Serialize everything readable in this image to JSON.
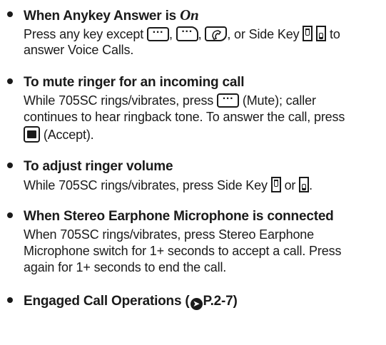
{
  "items": [
    {
      "head_pre": "When Anykey Answer is ",
      "head_em": "On",
      "l1_a": "Press any key except ",
      "l1_b": ", ",
      "l1_c": ", ",
      "l1_d": ", or Side Key ",
      "l1_e": " ",
      "l1_f": " to",
      "l2": "answer Voice Calls."
    },
    {
      "head": "To mute ringer for an incoming call",
      "l1_a": "While 705SC rings/vibrates, press ",
      "l1_b": " (Mute); caller",
      "l2": "continues to hear ringback tone. To answer the call, press",
      "l3": " (Accept)."
    },
    {
      "head": "To adjust ringer volume",
      "l1_a": "While 705SC rings/vibrates, press Side Key ",
      "l1_b": " or ",
      "l1_c": "."
    },
    {
      "head": "When Stereo Earphone Microphone is connected",
      "l1": "When 705SC rings/vibrates, press Stereo Earphone",
      "l2": "Microphone switch for 1+ seconds to accept a call. Press",
      "l3": "again for 1+ seconds to end the call."
    },
    {
      "head_pre": "Engaged Call Operations (",
      "head_ref": "P.2-7",
      "head_post": ")"
    }
  ],
  "icons": {
    "soft_left": "soft-key-left-icon",
    "soft_right": "soft-key-right-icon",
    "end_key": "end-key-icon",
    "side_up": "side-key-up-icon",
    "side_down": "side-key-down-icon",
    "center_key": "center-key-icon",
    "ref_arrow": "arrow-reference-icon"
  }
}
